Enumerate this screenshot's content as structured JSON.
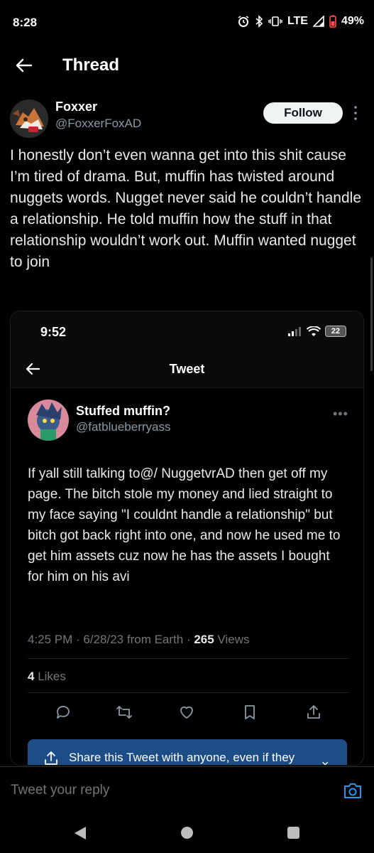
{
  "status_bar": {
    "time": "8:28",
    "network": "LTE",
    "battery": "49%"
  },
  "header": {
    "title": "Thread",
    "back_icon": "arrow-left-icon"
  },
  "tweet": {
    "author_name": "Foxxer",
    "author_handle": "@FoxxerFoxAD",
    "follow_label": "Follow",
    "text": "I honestly don’t even wanna get into this shit cause I’m tired of drama. But, muffin has twisted around nuggets words. Nugget never said he couldn’t handle a relationship. He told muffin how the stuff in that relationship wouldn’t work out. Muffin wanted nugget to join"
  },
  "embedded_screenshot": {
    "time": "9:52",
    "battery": "22",
    "nav_title": "Tweet",
    "author_name": "Stuffed muffin?",
    "author_handle": "@fatblueberryass",
    "more": "•••",
    "text": "If yall still talking to@/ NuggetvrAD then get off my page. The bitch stole my money and lied straight to my face saying \"I couldnt handle a relationship\" but bitch got back right into one, and now he used me to get him assets cuz now he has the assets I bought for him on his avi",
    "meta_prefix": "4:25 PM · 6/28/23 from Earth · ",
    "views_count": "265",
    "views_label": " Views",
    "likes_count": "4",
    "likes_label": " Likes",
    "toast_text": "Share this Tweet with anyone, even if they",
    "toast_close": "×",
    "actions": [
      "reply-icon",
      "retweet-icon",
      "like-icon",
      "bookmark-icon",
      "share-icon"
    ]
  },
  "reply_bar": {
    "placeholder": "Tweet your reply"
  },
  "colors": {
    "background": "#000000",
    "accent": "#1d9bf0",
    "secondary_text": "#71767b",
    "toast": "#1d4d87"
  }
}
